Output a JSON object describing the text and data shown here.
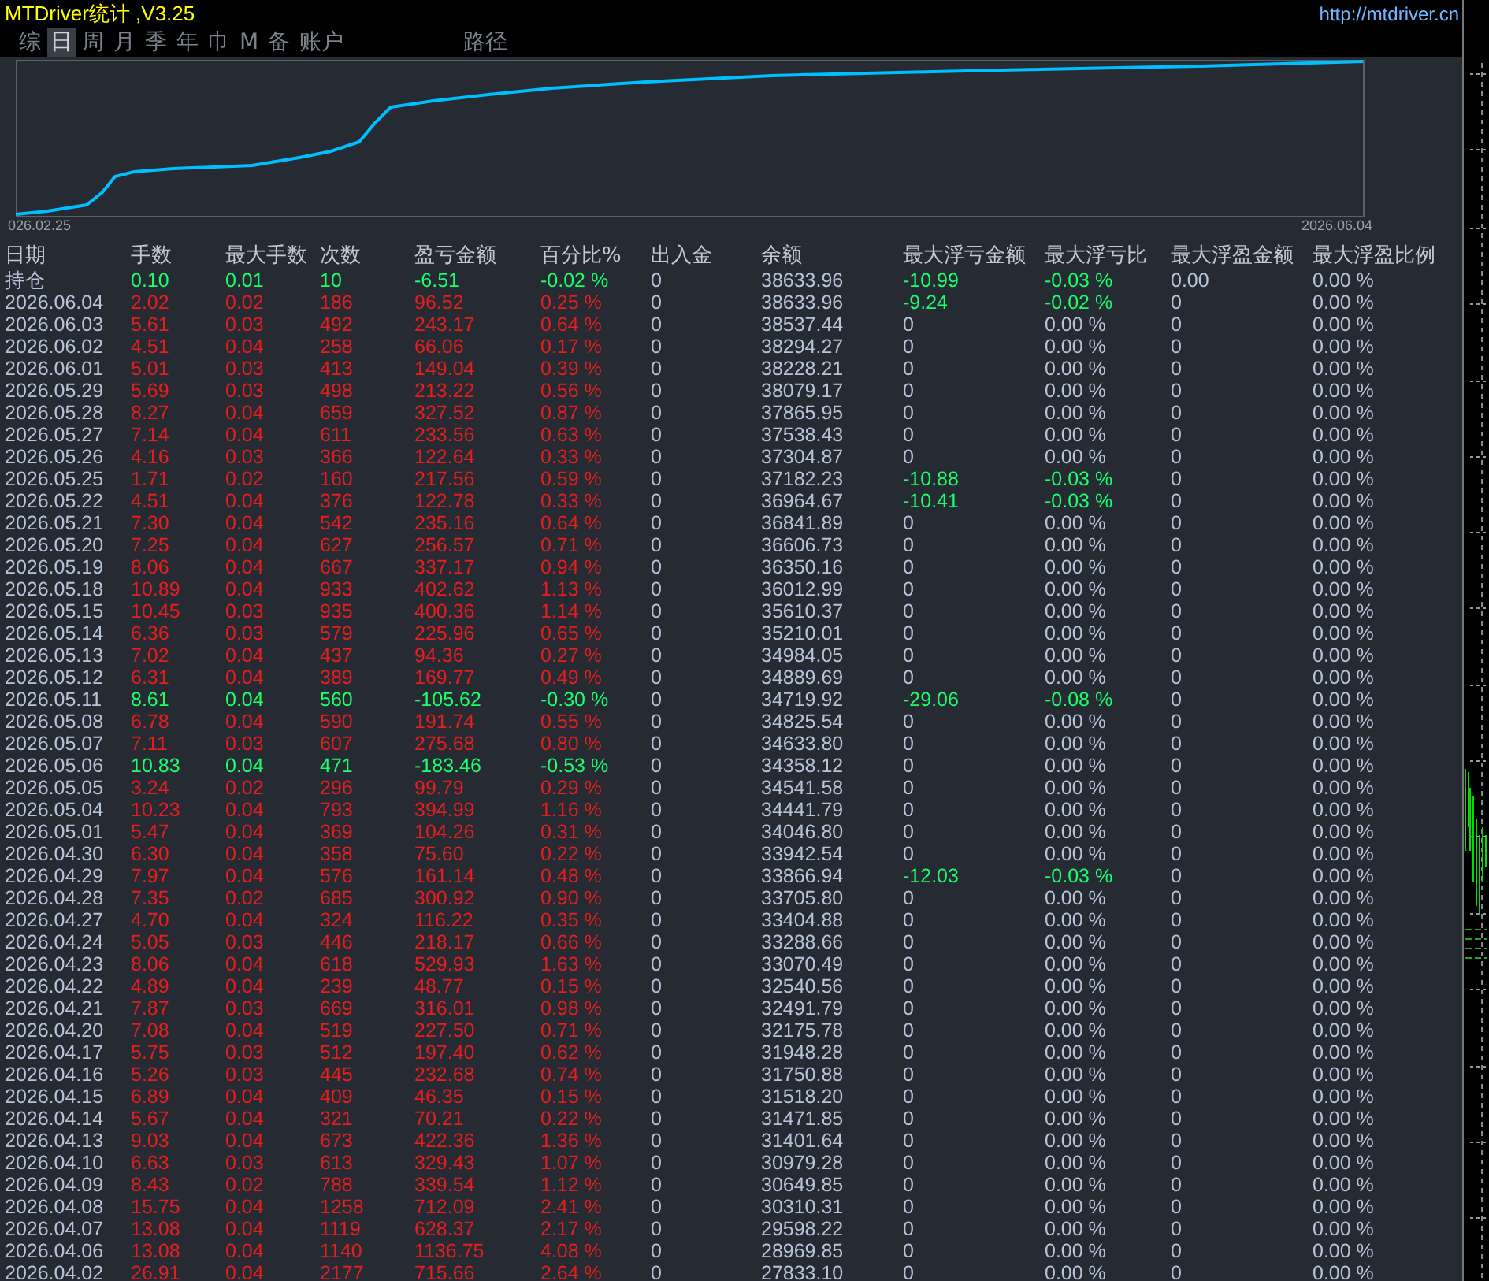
{
  "title": "MTDriver统计 ,V3.25",
  "url": "http://mtdriver.cn",
  "tabs": [
    {
      "label": "综",
      "selected": false
    },
    {
      "label": "日",
      "selected": true
    },
    {
      "label": "周",
      "selected": false
    },
    {
      "label": "月",
      "selected": false
    },
    {
      "label": "季",
      "selected": false
    },
    {
      "label": "年",
      "selected": false
    },
    {
      "label": "巾",
      "selected": false
    },
    {
      "label": "M",
      "selected": false
    },
    {
      "label": "备",
      "selected": false
    },
    {
      "label": "账户",
      "selected": false
    }
  ],
  "path_button": {
    "label": "路径"
  },
  "chart": {
    "start_label": "026.02.25",
    "end_label": "2026.06.04"
  },
  "table": {
    "columns": [
      "日期",
      "手数",
      "最大手数",
      "次数",
      "盈亏金额",
      "百分比%",
      "出入金",
      "余额",
      "最大浮亏金额",
      "最大浮亏比",
      "最大浮盈金额",
      "最大浮盈比例"
    ],
    "rows": [
      {
        "cells": [
          "持仓",
          "0.10",
          "0.01",
          "10",
          "-6.51",
          "-0.02 %",
          "0",
          "38633.96",
          "-10.99",
          "-0.03 %",
          "0.00",
          "0.00 %"
        ],
        "profit": false,
        "drawdown": true
      },
      {
        "cells": [
          "2026.06.04",
          "2.02",
          "0.02",
          "186",
          "96.52",
          "0.25 %",
          "0",
          "38633.96",
          "-9.24",
          "-0.02 %",
          "0",
          "0.00 %"
        ],
        "profit": true,
        "drawdown": true
      },
      {
        "cells": [
          "2026.06.03",
          "5.61",
          "0.03",
          "492",
          "243.17",
          "0.64 %",
          "0",
          "38537.44",
          "0",
          "0.00 %",
          "0",
          "0.00 %"
        ],
        "profit": true,
        "drawdown": false
      },
      {
        "cells": [
          "2026.06.02",
          "4.51",
          "0.04",
          "258",
          "66.06",
          "0.17 %",
          "0",
          "38294.27",
          "0",
          "0.00 %",
          "0",
          "0.00 %"
        ],
        "profit": true,
        "drawdown": false
      },
      {
        "cells": [
          "2026.06.01",
          "5.01",
          "0.03",
          "413",
          "149.04",
          "0.39 %",
          "0",
          "38228.21",
          "0",
          "0.00 %",
          "0",
          "0.00 %"
        ],
        "profit": true,
        "drawdown": false
      },
      {
        "cells": [
          "2026.05.29",
          "5.69",
          "0.03",
          "498",
          "213.22",
          "0.56 %",
          "0",
          "38079.17",
          "0",
          "0.00 %",
          "0",
          "0.00 %"
        ],
        "profit": true,
        "drawdown": false
      },
      {
        "cells": [
          "2026.05.28",
          "8.27",
          "0.04",
          "659",
          "327.52",
          "0.87 %",
          "0",
          "37865.95",
          "0",
          "0.00 %",
          "0",
          "0.00 %"
        ],
        "profit": true,
        "drawdown": false
      },
      {
        "cells": [
          "2026.05.27",
          "7.14",
          "0.04",
          "611",
          "233.56",
          "0.63 %",
          "0",
          "37538.43",
          "0",
          "0.00 %",
          "0",
          "0.00 %"
        ],
        "profit": true,
        "drawdown": false
      },
      {
        "cells": [
          "2026.05.26",
          "4.16",
          "0.03",
          "366",
          "122.64",
          "0.33 %",
          "0",
          "37304.87",
          "0",
          "0.00 %",
          "0",
          "0.00 %"
        ],
        "profit": true,
        "drawdown": false
      },
      {
        "cells": [
          "2026.05.25",
          "1.71",
          "0.02",
          "160",
          "217.56",
          "0.59 %",
          "0",
          "37182.23",
          "-10.88",
          "-0.03 %",
          "0",
          "0.00 %"
        ],
        "profit": true,
        "drawdown": true
      },
      {
        "cells": [
          "2026.05.22",
          "4.51",
          "0.04",
          "376",
          "122.78",
          "0.33 %",
          "0",
          "36964.67",
          "-10.41",
          "-0.03 %",
          "0",
          "0.00 %"
        ],
        "profit": true,
        "drawdown": true
      },
      {
        "cells": [
          "2026.05.21",
          "7.30",
          "0.04",
          "542",
          "235.16",
          "0.64 %",
          "0",
          "36841.89",
          "0",
          "0.00 %",
          "0",
          "0.00 %"
        ],
        "profit": true,
        "drawdown": false
      },
      {
        "cells": [
          "2026.05.20",
          "7.25",
          "0.04",
          "627",
          "256.57",
          "0.71 %",
          "0",
          "36606.73",
          "0",
          "0.00 %",
          "0",
          "0.00 %"
        ],
        "profit": true,
        "drawdown": false
      },
      {
        "cells": [
          "2026.05.19",
          "8.06",
          "0.04",
          "667",
          "337.17",
          "0.94 %",
          "0",
          "36350.16",
          "0",
          "0.00 %",
          "0",
          "0.00 %"
        ],
        "profit": true,
        "drawdown": false
      },
      {
        "cells": [
          "2026.05.18",
          "10.89",
          "0.04",
          "933",
          "402.62",
          "1.13 %",
          "0",
          "36012.99",
          "0",
          "0.00 %",
          "0",
          "0.00 %"
        ],
        "profit": true,
        "drawdown": false
      },
      {
        "cells": [
          "2026.05.15",
          "10.45",
          "0.03",
          "935",
          "400.36",
          "1.14 %",
          "0",
          "35610.37",
          "0",
          "0.00 %",
          "0",
          "0.00 %"
        ],
        "profit": true,
        "drawdown": false
      },
      {
        "cells": [
          "2026.05.14",
          "6.36",
          "0.03",
          "579",
          "225.96",
          "0.65 %",
          "0",
          "35210.01",
          "0",
          "0.00 %",
          "0",
          "0.00 %"
        ],
        "profit": true,
        "drawdown": false
      },
      {
        "cells": [
          "2026.05.13",
          "7.02",
          "0.04",
          "437",
          "94.36",
          "0.27 %",
          "0",
          "34984.05",
          "0",
          "0.00 %",
          "0",
          "0.00 %"
        ],
        "profit": true,
        "drawdown": false
      },
      {
        "cells": [
          "2026.05.12",
          "6.31",
          "0.04",
          "389",
          "169.77",
          "0.49 %",
          "0",
          "34889.69",
          "0",
          "0.00 %",
          "0",
          "0.00 %"
        ],
        "profit": true,
        "drawdown": false
      },
      {
        "cells": [
          "2026.05.11",
          "8.61",
          "0.04",
          "560",
          "-105.62",
          "-0.30 %",
          "0",
          "34719.92",
          "-29.06",
          "-0.08 %",
          "0",
          "0.00 %"
        ],
        "profit": false,
        "drawdown": true
      },
      {
        "cells": [
          "2026.05.08",
          "6.78",
          "0.04",
          "590",
          "191.74",
          "0.55 %",
          "0",
          "34825.54",
          "0",
          "0.00 %",
          "0",
          "0.00 %"
        ],
        "profit": true,
        "drawdown": false
      },
      {
        "cells": [
          "2026.05.07",
          "7.11",
          "0.03",
          "607",
          "275.68",
          "0.80 %",
          "0",
          "34633.80",
          "0",
          "0.00 %",
          "0",
          "0.00 %"
        ],
        "profit": true,
        "drawdown": false
      },
      {
        "cells": [
          "2026.05.06",
          "10.83",
          "0.04",
          "471",
          "-183.46",
          "-0.53 %",
          "0",
          "34358.12",
          "0",
          "0.00 %",
          "0",
          "0.00 %"
        ],
        "profit": false,
        "drawdown": false
      },
      {
        "cells": [
          "2026.05.05",
          "3.24",
          "0.02",
          "296",
          "99.79",
          "0.29 %",
          "0",
          "34541.58",
          "0",
          "0.00 %",
          "0",
          "0.00 %"
        ],
        "profit": true,
        "drawdown": false
      },
      {
        "cells": [
          "2026.05.04",
          "10.23",
          "0.04",
          "793",
          "394.99",
          "1.16 %",
          "0",
          "34441.79",
          "0",
          "0.00 %",
          "0",
          "0.00 %"
        ],
        "profit": true,
        "drawdown": false
      },
      {
        "cells": [
          "2026.05.01",
          "5.47",
          "0.04",
          "369",
          "104.26",
          "0.31 %",
          "0",
          "34046.80",
          "0",
          "0.00 %",
          "0",
          "0.00 %"
        ],
        "profit": true,
        "drawdown": false
      },
      {
        "cells": [
          "2026.04.30",
          "6.30",
          "0.04",
          "358",
          "75.60",
          "0.22 %",
          "0",
          "33942.54",
          "0",
          "0.00 %",
          "0",
          "0.00 %"
        ],
        "profit": true,
        "drawdown": false
      },
      {
        "cells": [
          "2026.04.29",
          "7.97",
          "0.04",
          "576",
          "161.14",
          "0.48 %",
          "0",
          "33866.94",
          "-12.03",
          "-0.03 %",
          "0",
          "0.00 %"
        ],
        "profit": true,
        "drawdown": true
      },
      {
        "cells": [
          "2026.04.28",
          "7.35",
          "0.02",
          "685",
          "300.92",
          "0.90 %",
          "0",
          "33705.80",
          "0",
          "0.00 %",
          "0",
          "0.00 %"
        ],
        "profit": true,
        "drawdown": false
      },
      {
        "cells": [
          "2026.04.27",
          "4.70",
          "0.04",
          "324",
          "116.22",
          "0.35 %",
          "0",
          "33404.88",
          "0",
          "0.00 %",
          "0",
          "0.00 %"
        ],
        "profit": true,
        "drawdown": false
      },
      {
        "cells": [
          "2026.04.24",
          "5.05",
          "0.03",
          "446",
          "218.17",
          "0.66 %",
          "0",
          "33288.66",
          "0",
          "0.00 %",
          "0",
          "0.00 %"
        ],
        "profit": true,
        "drawdown": false
      },
      {
        "cells": [
          "2026.04.23",
          "8.06",
          "0.04",
          "618",
          "529.93",
          "1.63 %",
          "0",
          "33070.49",
          "0",
          "0.00 %",
          "0",
          "0.00 %"
        ],
        "profit": true,
        "drawdown": false
      },
      {
        "cells": [
          "2026.04.22",
          "4.89",
          "0.04",
          "239",
          "48.77",
          "0.15 %",
          "0",
          "32540.56",
          "0",
          "0.00 %",
          "0",
          "0.00 %"
        ],
        "profit": true,
        "drawdown": false
      },
      {
        "cells": [
          "2026.04.21",
          "7.87",
          "0.03",
          "669",
          "316.01",
          "0.98 %",
          "0",
          "32491.79",
          "0",
          "0.00 %",
          "0",
          "0.00 %"
        ],
        "profit": true,
        "drawdown": false
      },
      {
        "cells": [
          "2026.04.20",
          "7.08",
          "0.04",
          "519",
          "227.50",
          "0.71 %",
          "0",
          "32175.78",
          "0",
          "0.00 %",
          "0",
          "0.00 %"
        ],
        "profit": true,
        "drawdown": false
      },
      {
        "cells": [
          "2026.04.17",
          "5.75",
          "0.03",
          "512",
          "197.40",
          "0.62 %",
          "0",
          "31948.28",
          "0",
          "0.00 %",
          "0",
          "0.00 %"
        ],
        "profit": true,
        "drawdown": false
      },
      {
        "cells": [
          "2026.04.16",
          "5.26",
          "0.03",
          "445",
          "232.68",
          "0.74 %",
          "0",
          "31750.88",
          "0",
          "0.00 %",
          "0",
          "0.00 %"
        ],
        "profit": true,
        "drawdown": false
      },
      {
        "cells": [
          "2026.04.15",
          "6.89",
          "0.04",
          "409",
          "46.35",
          "0.15 %",
          "0",
          "31518.20",
          "0",
          "0.00 %",
          "0",
          "0.00 %"
        ],
        "profit": true,
        "drawdown": false
      },
      {
        "cells": [
          "2026.04.14",
          "5.67",
          "0.04",
          "321",
          "70.21",
          "0.22 %",
          "0",
          "31471.85",
          "0",
          "0.00 %",
          "0",
          "0.00 %"
        ],
        "profit": true,
        "drawdown": false
      },
      {
        "cells": [
          "2026.04.13",
          "9.03",
          "0.04",
          "673",
          "422.36",
          "1.36 %",
          "0",
          "31401.64",
          "0",
          "0.00 %",
          "0",
          "0.00 %"
        ],
        "profit": true,
        "drawdown": false
      },
      {
        "cells": [
          "2026.04.10",
          "6.63",
          "0.03",
          "613",
          "329.43",
          "1.07 %",
          "0",
          "30979.28",
          "0",
          "0.00 %",
          "0",
          "0.00 %"
        ],
        "profit": true,
        "drawdown": false
      },
      {
        "cells": [
          "2026.04.09",
          "8.43",
          "0.02",
          "788",
          "339.54",
          "1.12 %",
          "0",
          "30649.85",
          "0",
          "0.00 %",
          "0",
          "0.00 %"
        ],
        "profit": true,
        "drawdown": false
      },
      {
        "cells": [
          "2026.04.08",
          "15.75",
          "0.04",
          "1258",
          "712.09",
          "2.41 %",
          "0",
          "30310.31",
          "0",
          "0.00 %",
          "0",
          "0.00 %"
        ],
        "profit": true,
        "drawdown": false
      },
      {
        "cells": [
          "2026.04.07",
          "13.08",
          "0.04",
          "1119",
          "628.37",
          "2.17 %",
          "0",
          "29598.22",
          "0",
          "0.00 %",
          "0",
          "0.00 %"
        ],
        "profit": true,
        "drawdown": false
      },
      {
        "cells": [
          "2026.04.06",
          "13.08",
          "0.04",
          "1140",
          "1136.75",
          "4.08 %",
          "0",
          "28969.85",
          "0",
          "0.00 %",
          "0",
          "0.00 %"
        ],
        "profit": true,
        "drawdown": false
      },
      {
        "cells": [
          "2026.04.02",
          "26.91",
          "0.04",
          "2177",
          "715.66",
          "2.64 %",
          "0",
          "27833.10",
          "0",
          "0.00 %",
          "0",
          "0.00 %"
        ],
        "profit": true,
        "drawdown": false
      }
    ]
  }
}
